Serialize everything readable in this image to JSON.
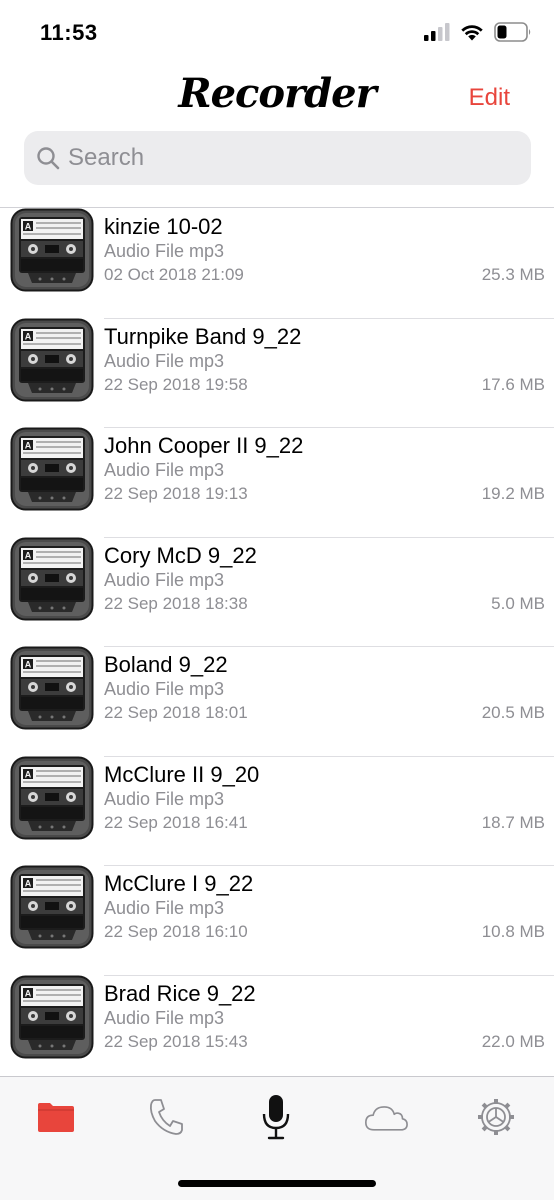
{
  "status_bar": {
    "time": "11:53",
    "signal_icon": "cellular-signal-icon",
    "wifi_icon": "wifi-icon",
    "battery_icon": "battery-icon"
  },
  "nav": {
    "title": "Recorder",
    "edit_label": "Edit",
    "accent_color": "#e8453c"
  },
  "search": {
    "placeholder": "Search",
    "value": ""
  },
  "recordings": [
    {
      "title": "kinzie 10-02",
      "type": "Audio File mp3",
      "date": "02 Oct 2018 21:09",
      "size": "25.3 MB",
      "icon": "cassette-tape-icon"
    },
    {
      "title": "Turnpike Band 9_22",
      "type": "Audio File mp3",
      "date": "22 Sep 2018 19:58",
      "size": "17.6 MB",
      "icon": "cassette-tape-icon"
    },
    {
      "title": "John Cooper II 9_22",
      "type": "Audio File mp3",
      "date": "22 Sep 2018 19:13",
      "size": "19.2 MB",
      "icon": "cassette-tape-icon"
    },
    {
      "title": "Cory McD 9_22",
      "type": "Audio File mp3",
      "date": "22 Sep 2018 18:38",
      "size": "5.0 MB",
      "icon": "cassette-tape-icon"
    },
    {
      "title": "Boland 9_22",
      "type": "Audio File mp3",
      "date": "22 Sep 2018 18:01",
      "size": "20.5 MB",
      "icon": "cassette-tape-icon"
    },
    {
      "title": "McClure II 9_20",
      "type": "Audio File mp3",
      "date": "22 Sep 2018 16:41",
      "size": "18.7 MB",
      "icon": "cassette-tape-icon"
    },
    {
      "title": "McClure I 9_22",
      "type": "Audio File mp3",
      "date": "22 Sep 2018 16:10",
      "size": "10.8 MB",
      "icon": "cassette-tape-icon"
    },
    {
      "title": "Brad Rice 9_22",
      "type": "Audio File mp3",
      "date": "22 Sep 2018 15:43",
      "size": "22.0 MB",
      "icon": "cassette-tape-icon"
    }
  ],
  "tab_bar": {
    "tabs": [
      {
        "icon": "folder-icon",
        "active": true
      },
      {
        "icon": "phone-icon",
        "active": false
      },
      {
        "icon": "microphone-icon",
        "active": false
      },
      {
        "icon": "cloud-icon",
        "active": false
      },
      {
        "icon": "settings-gear-icon",
        "active": false
      }
    ]
  }
}
